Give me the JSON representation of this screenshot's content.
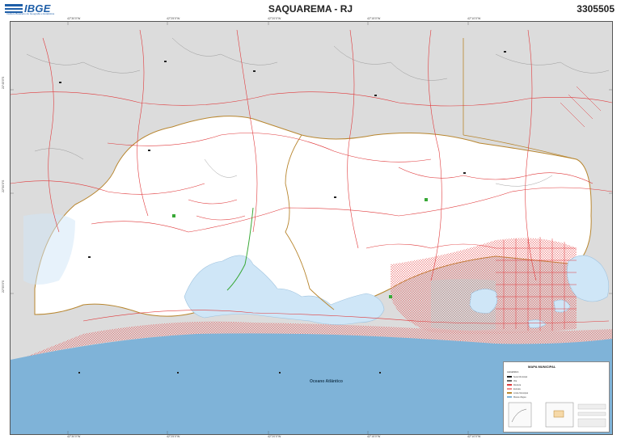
{
  "header": {
    "logo_text": "IBGE",
    "logo_subtitle": "Instituto Brasileiro de Geografia e Estatística",
    "title": "SAQUAREMA - RJ",
    "code": "3305505"
  },
  "map": {
    "ocean_label": "Oceano Atlântico",
    "colors": {
      "ocean": "#7fb3d8",
      "lagoon": "#cfe6f7",
      "municipality": "#ffffff",
      "neighbor": "#dcdcdc",
      "roads": "#e0393b",
      "limits": "#b8862f",
      "drainage": "#8a8a8a",
      "urban_hatch": "#e85a5a"
    },
    "grid_labels": {
      "top": [
        "42°30'0\"W",
        "42°25'0\"W",
        "42°20'0\"W",
        "42°15'0\"W",
        "42°10'0\"W"
      ],
      "bottom": [
        "42°30'0\"W",
        "42°25'0\"W",
        "42°20'0\"W",
        "42°15'0\"W",
        "42°10'0\"W"
      ],
      "left": [
        "22°45'0\"S",
        "22°50'0\"S",
        "22°55'0\"S"
      ],
      "right": [
        "22°45'0\"S",
        "22°50'0\"S",
        "22°55'0\"S"
      ]
    }
  },
  "legend": {
    "title": "MAPA MUNICIPAL",
    "subtitle": "LEGENDA",
    "items": [
      "Sede Municipal",
      "Vila",
      "Rodovia",
      "Estrada",
      "Limite Municipal",
      "Massa d'água"
    ]
  }
}
